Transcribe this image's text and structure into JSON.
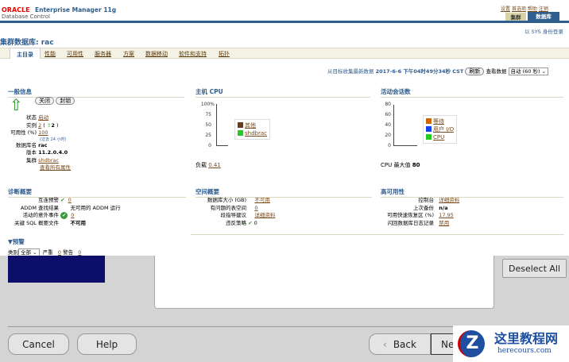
{
  "header": {
    "logo": "ORACLE",
    "product": "Enterprise Manager 11g",
    "subtitle": "Database Control",
    "links": [
      "设置",
      "首选项",
      "帮助",
      "注销"
    ],
    "tabs": [
      "集群",
      "数据库"
    ],
    "login": "以 SYS 身份登录"
  },
  "page_title": "集群数据库: rac",
  "nav_tabs": [
    "主目录",
    "性能",
    "可用性",
    "服务器",
    "方案",
    "数据移动",
    "软件和支持",
    "拓扑"
  ],
  "refresh": {
    "label": "从目标收集最新数据",
    "timestamp": "2017-6-6 下午04时49分34秒 CST",
    "button": "刷新",
    "view_label": "查看数据",
    "view_value": "自动 (60 秒)"
  },
  "general": {
    "title": "一般信息",
    "btn_close": "关闭",
    "btn_lock": "封锁",
    "status_label": "状态",
    "status": "启动",
    "instances_label": "实例",
    "instances": "2",
    "instances_up": "2",
    "availability_label": "可用性 (%)",
    "availability": "100",
    "availability_note": "(过去 24 小时)",
    "dbname_label": "数据库名",
    "dbname": "rac",
    "version_label": "版本",
    "version": "11.2.0.4.0",
    "cluster_label": "集群",
    "cluster": "shdbrac",
    "all_props": "查看所有属性"
  },
  "cpu": {
    "title": "主机 CPU",
    "ticks": [
      "100%",
      "75",
      "50",
      "25",
      "0"
    ],
    "legend": [
      "其他",
      "shdbrac"
    ],
    "legend_colors": [
      "#6b3a1a",
      "#22cc22"
    ],
    "load_label": "负载",
    "load": "0.41"
  },
  "sessions": {
    "title": "活动会话数",
    "ticks": [
      "80",
      "60",
      "40",
      "20",
      "0"
    ],
    "legend": [
      "等待",
      "用户 I/O",
      "CPU"
    ],
    "legend_colors": [
      "#cc6600",
      "#1144ee",
      "#22cc22"
    ],
    "max_label": "CPU 最大值",
    "max": "80"
  },
  "diag": {
    "title": "诊断概要",
    "interconnect_label": "互连预警",
    "interconnect": "0",
    "addm_label": "ADDM 查找结果",
    "addm": "无可用的 ADDM 运行",
    "incidents_label": "活动的意外事件",
    "incidents": "0",
    "sql_label": "关键 SQL 概要文件",
    "sql": "不可用"
  },
  "space": {
    "title": "空间概要",
    "size_label": "数据库大小 (GB)",
    "size": "不可用",
    "problem_label": "有问题的表空间",
    "problem": "0",
    "advice_label": "段指导建议",
    "advice": "详细资料",
    "policy_label": "违反策略",
    "policy": "0"
  },
  "ha": {
    "title": "高可用性",
    "console_label": "控制台",
    "console": "详细资料",
    "backup_label": "上次备份",
    "backup": "n/a",
    "fra_label": "可用快速恢复区 (%)",
    "fra": "17.95",
    "flashback_label": "闪回数据库日志记录",
    "flashback": "禁用"
  },
  "alerts": {
    "title": "▼预警",
    "category_label": "类别",
    "category": "全部",
    "critical_label": "严重",
    "critical": "0",
    "warning_label": "警告",
    "warning": "0"
  },
  "installer": {
    "deselect": "Deselect All",
    "cancel": "Cancel",
    "help": "Help",
    "back": "Back",
    "next": "Ne"
  },
  "watermark": {
    "title": "这里教程网",
    "url": "herecours.com"
  }
}
